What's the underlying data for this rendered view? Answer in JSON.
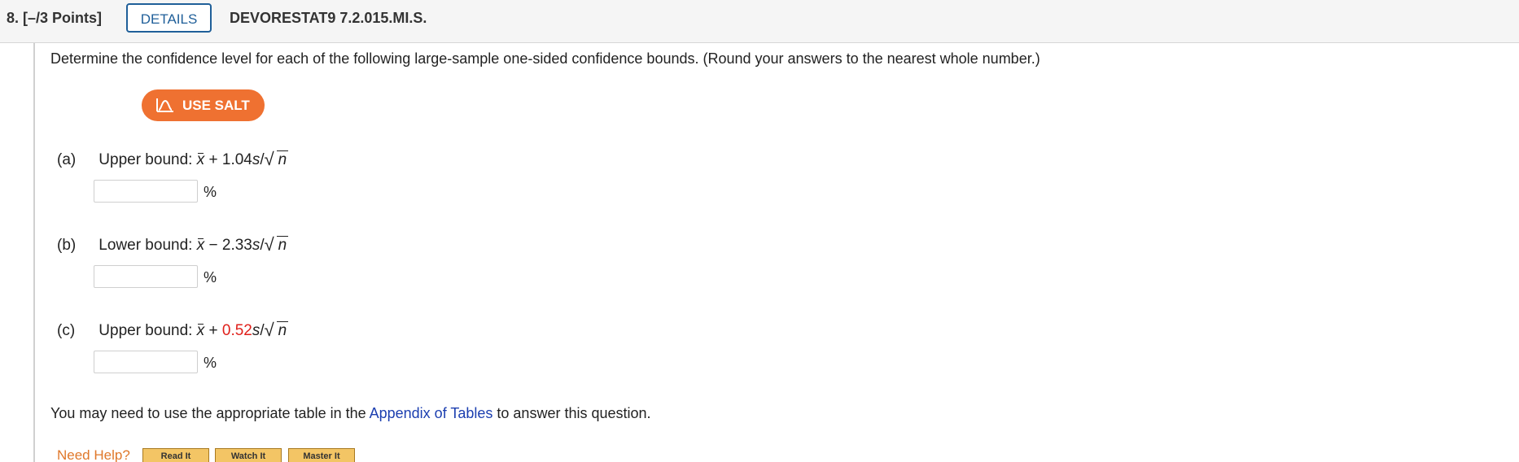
{
  "header": {
    "question_number": "8.  [–/3 Points]",
    "details_label": "DETAILS",
    "question_id": "DEVORESTAT9 7.2.015.MI.S."
  },
  "prompt": "Determine the confidence level for each of the following large-sample one-sided confidence bounds. (Round your answers to the nearest whole number.)",
  "salt_button": {
    "label": "USE SALT",
    "icon": "salt-distribution-icon"
  },
  "parts": [
    {
      "label": "(a)",
      "bound": "Upper bound:",
      "x": "x",
      "op": "+",
      "coef": "1.04",
      "s": "s",
      "slash": "/",
      "n": "n",
      "highlight": false,
      "value": "",
      "unit": "%"
    },
    {
      "label": "(b)",
      "bound": "Lower bound:",
      "x": "x",
      "op": "−",
      "coef": "2.33",
      "s": "s",
      "slash": "/",
      "n": "n",
      "highlight": false,
      "value": "",
      "unit": "%"
    },
    {
      "label": "(c)",
      "bound": "Upper bound:",
      "x": "x",
      "op": "+",
      "coef": "0.52",
      "s": "s",
      "slash": "/",
      "n": "n",
      "highlight": true,
      "value": "",
      "unit": "%"
    }
  ],
  "note": {
    "before": "You may need to use the appropriate table in the ",
    "link": "Appendix of Tables",
    "after": " to answer this question."
  },
  "help": {
    "label": "Need Help?",
    "buttons": [
      "Read It",
      "Watch It",
      "Master It"
    ]
  },
  "colors": {
    "accent_blue": "#1f5f99",
    "salt_orange": "#ef7131",
    "highlight_red": "#e0201b",
    "link_blue": "#1c3fb0",
    "help_orange": "#e0782a"
  }
}
